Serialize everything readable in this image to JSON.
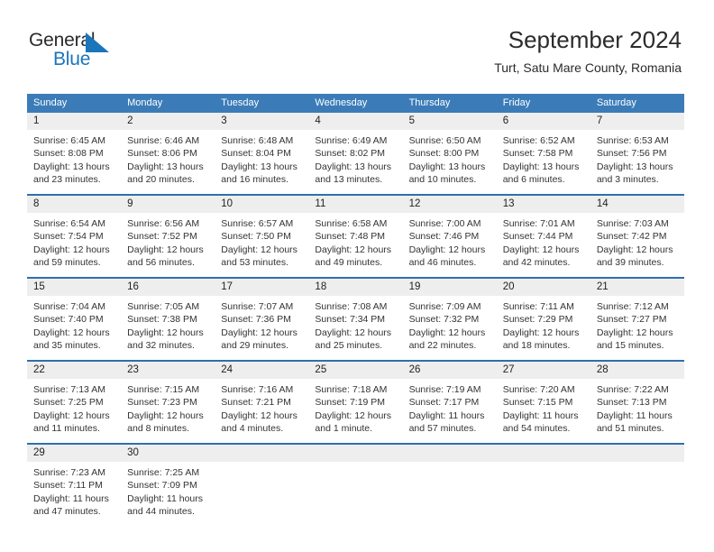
{
  "logo": {
    "text_primary": "General",
    "text_secondary": "Blue",
    "mark": "triangle-flag-icon",
    "color_primary": "#2b2b2b",
    "color_secondary": "#1b75bb"
  },
  "header": {
    "title": "September 2024",
    "subtitle": "Turt, Satu Mare County, Romania"
  },
  "theme": {
    "header_bar": "#3b7cb8",
    "week_divider": "#2f6fae",
    "date_band": "#eeeeee",
    "text": "#333333"
  },
  "weekdays": [
    "Sunday",
    "Monday",
    "Tuesday",
    "Wednesday",
    "Thursday",
    "Friday",
    "Saturday"
  ],
  "weeks": [
    {
      "days": [
        {
          "date": "1",
          "sunrise": "Sunrise: 6:45 AM",
          "sunset": "Sunset: 8:08 PM",
          "daylight": "Daylight: 13 hours and 23 minutes."
        },
        {
          "date": "2",
          "sunrise": "Sunrise: 6:46 AM",
          "sunset": "Sunset: 8:06 PM",
          "daylight": "Daylight: 13 hours and 20 minutes."
        },
        {
          "date": "3",
          "sunrise": "Sunrise: 6:48 AM",
          "sunset": "Sunset: 8:04 PM",
          "daylight": "Daylight: 13 hours and 16 minutes."
        },
        {
          "date": "4",
          "sunrise": "Sunrise: 6:49 AM",
          "sunset": "Sunset: 8:02 PM",
          "daylight": "Daylight: 13 hours and 13 minutes."
        },
        {
          "date": "5",
          "sunrise": "Sunrise: 6:50 AM",
          "sunset": "Sunset: 8:00 PM",
          "daylight": "Daylight: 13 hours and 10 minutes."
        },
        {
          "date": "6",
          "sunrise": "Sunrise: 6:52 AM",
          "sunset": "Sunset: 7:58 PM",
          "daylight": "Daylight: 13 hours and 6 minutes."
        },
        {
          "date": "7",
          "sunrise": "Sunrise: 6:53 AM",
          "sunset": "Sunset: 7:56 PM",
          "daylight": "Daylight: 13 hours and 3 minutes."
        }
      ]
    },
    {
      "days": [
        {
          "date": "8",
          "sunrise": "Sunrise: 6:54 AM",
          "sunset": "Sunset: 7:54 PM",
          "daylight": "Daylight: 12 hours and 59 minutes."
        },
        {
          "date": "9",
          "sunrise": "Sunrise: 6:56 AM",
          "sunset": "Sunset: 7:52 PM",
          "daylight": "Daylight: 12 hours and 56 minutes."
        },
        {
          "date": "10",
          "sunrise": "Sunrise: 6:57 AM",
          "sunset": "Sunset: 7:50 PM",
          "daylight": "Daylight: 12 hours and 53 minutes."
        },
        {
          "date": "11",
          "sunrise": "Sunrise: 6:58 AM",
          "sunset": "Sunset: 7:48 PM",
          "daylight": "Daylight: 12 hours and 49 minutes."
        },
        {
          "date": "12",
          "sunrise": "Sunrise: 7:00 AM",
          "sunset": "Sunset: 7:46 PM",
          "daylight": "Daylight: 12 hours and 46 minutes."
        },
        {
          "date": "13",
          "sunrise": "Sunrise: 7:01 AM",
          "sunset": "Sunset: 7:44 PM",
          "daylight": "Daylight: 12 hours and 42 minutes."
        },
        {
          "date": "14",
          "sunrise": "Sunrise: 7:03 AM",
          "sunset": "Sunset: 7:42 PM",
          "daylight": "Daylight: 12 hours and 39 minutes."
        }
      ]
    },
    {
      "days": [
        {
          "date": "15",
          "sunrise": "Sunrise: 7:04 AM",
          "sunset": "Sunset: 7:40 PM",
          "daylight": "Daylight: 12 hours and 35 minutes."
        },
        {
          "date": "16",
          "sunrise": "Sunrise: 7:05 AM",
          "sunset": "Sunset: 7:38 PM",
          "daylight": "Daylight: 12 hours and 32 minutes."
        },
        {
          "date": "17",
          "sunrise": "Sunrise: 7:07 AM",
          "sunset": "Sunset: 7:36 PM",
          "daylight": "Daylight: 12 hours and 29 minutes."
        },
        {
          "date": "18",
          "sunrise": "Sunrise: 7:08 AM",
          "sunset": "Sunset: 7:34 PM",
          "daylight": "Daylight: 12 hours and 25 minutes."
        },
        {
          "date": "19",
          "sunrise": "Sunrise: 7:09 AM",
          "sunset": "Sunset: 7:32 PM",
          "daylight": "Daylight: 12 hours and 22 minutes."
        },
        {
          "date": "20",
          "sunrise": "Sunrise: 7:11 AM",
          "sunset": "Sunset: 7:29 PM",
          "daylight": "Daylight: 12 hours and 18 minutes."
        },
        {
          "date": "21",
          "sunrise": "Sunrise: 7:12 AM",
          "sunset": "Sunset: 7:27 PM",
          "daylight": "Daylight: 12 hours and 15 minutes."
        }
      ]
    },
    {
      "days": [
        {
          "date": "22",
          "sunrise": "Sunrise: 7:13 AM",
          "sunset": "Sunset: 7:25 PM",
          "daylight": "Daylight: 12 hours and 11 minutes."
        },
        {
          "date": "23",
          "sunrise": "Sunrise: 7:15 AM",
          "sunset": "Sunset: 7:23 PM",
          "daylight": "Daylight: 12 hours and 8 minutes."
        },
        {
          "date": "24",
          "sunrise": "Sunrise: 7:16 AM",
          "sunset": "Sunset: 7:21 PM",
          "daylight": "Daylight: 12 hours and 4 minutes."
        },
        {
          "date": "25",
          "sunrise": "Sunrise: 7:18 AM",
          "sunset": "Sunset: 7:19 PM",
          "daylight": "Daylight: 12 hours and 1 minute."
        },
        {
          "date": "26",
          "sunrise": "Sunrise: 7:19 AM",
          "sunset": "Sunset: 7:17 PM",
          "daylight": "Daylight: 11 hours and 57 minutes."
        },
        {
          "date": "27",
          "sunrise": "Sunrise: 7:20 AM",
          "sunset": "Sunset: 7:15 PM",
          "daylight": "Daylight: 11 hours and 54 minutes."
        },
        {
          "date": "28",
          "sunrise": "Sunrise: 7:22 AM",
          "sunset": "Sunset: 7:13 PM",
          "daylight": "Daylight: 11 hours and 51 minutes."
        }
      ]
    },
    {
      "days": [
        {
          "date": "29",
          "sunrise": "Sunrise: 7:23 AM",
          "sunset": "Sunset: 7:11 PM",
          "daylight": "Daylight: 11 hours and 47 minutes."
        },
        {
          "date": "30",
          "sunrise": "Sunrise: 7:25 AM",
          "sunset": "Sunset: 7:09 PM",
          "daylight": "Daylight: 11 hours and 44 minutes."
        },
        {
          "date": "",
          "sunrise": "",
          "sunset": "",
          "daylight": ""
        },
        {
          "date": "",
          "sunrise": "",
          "sunset": "",
          "daylight": ""
        },
        {
          "date": "",
          "sunrise": "",
          "sunset": "",
          "daylight": ""
        },
        {
          "date": "",
          "sunrise": "",
          "sunset": "",
          "daylight": ""
        },
        {
          "date": "",
          "sunrise": "",
          "sunset": "",
          "daylight": ""
        }
      ]
    }
  ]
}
